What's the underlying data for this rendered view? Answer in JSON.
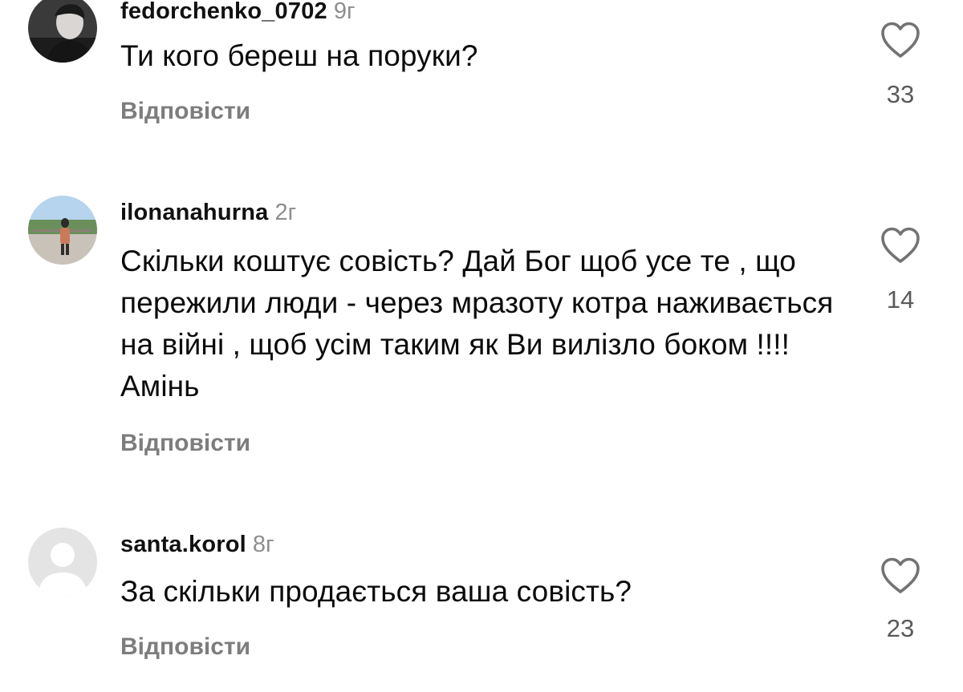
{
  "comments": [
    {
      "username": "fedorchenko_0702",
      "time": "9г",
      "text": "Ти кого береш на поруки?",
      "reply_label": "Відповісти",
      "like_count": "33",
      "like_icon": "heart-outline-icon"
    },
    {
      "username": "ilonanahurna",
      "time": "2г",
      "text": "Скільки коштує совість? Дай Бог щоб усе те , що пережили люди - через мразоту котра наживається на війні , щоб усім таким як Ви вилізло боком !!!! Амінь",
      "reply_label": "Відповісти",
      "like_count": "14",
      "like_icon": "heart-outline-icon"
    },
    {
      "username": "santa.korol",
      "time": "8г",
      "text": "За скільки продається ваша совість?",
      "reply_label": "Відповісти",
      "like_count": "23",
      "like_icon": "heart-outline-icon"
    }
  ],
  "colors": {
    "username": "#111111",
    "secondary": "#8e8e8e",
    "reply": "#7d7d7d",
    "text": "#0b0b0b"
  }
}
